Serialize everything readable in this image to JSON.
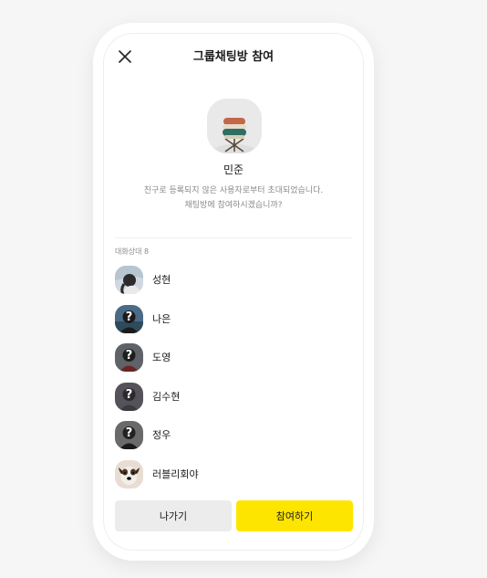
{
  "header": {
    "title": "그룹채팅방 참여",
    "close_icon": "close-icon"
  },
  "inviter": {
    "name": "민준",
    "description_line1": "친구로 등록되지 않은 사용자로부터 초대되었습니다.",
    "description_line2": "채팅방에 참여하시겠습니까?"
  },
  "members": {
    "header": "대화상대 8",
    "items": [
      {
        "name": "성현",
        "avatar": "photo-person"
      },
      {
        "name": "나은",
        "avatar": "unknown-person"
      },
      {
        "name": "도영",
        "avatar": "unknown-person"
      },
      {
        "name": "김수현",
        "avatar": "unknown-person"
      },
      {
        "name": "정우",
        "avatar": "unknown-person"
      },
      {
        "name": "러블리회야",
        "avatar": "photo-dog"
      }
    ]
  },
  "buttons": {
    "leave": "나가기",
    "join": "참여하기"
  },
  "colors": {
    "join_button": "#FEE500",
    "leave_button": "#ECECEC",
    "background": "#F6F6F6"
  }
}
